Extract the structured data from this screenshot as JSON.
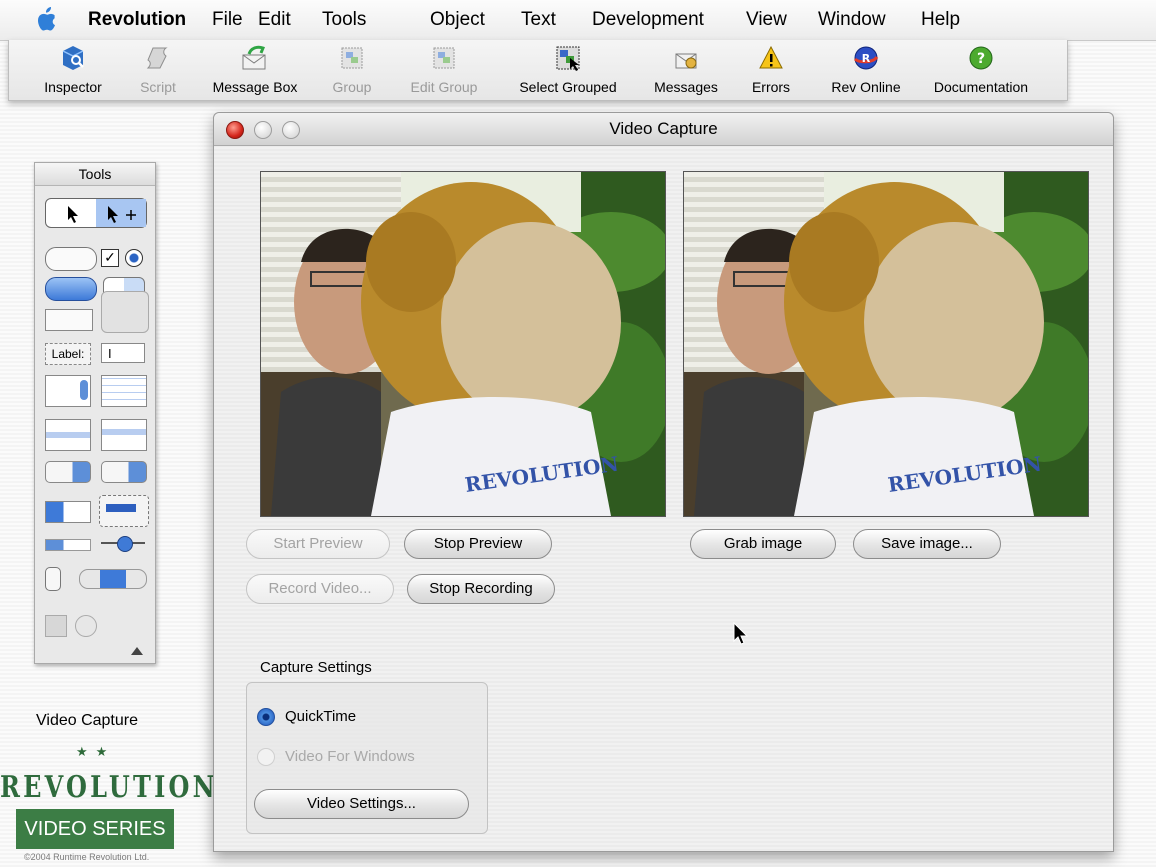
{
  "menubar": {
    "app_name": "Revolution",
    "items": [
      "File",
      "Edit",
      "Tools",
      "Object",
      "Text",
      "Development",
      "View",
      "Window",
      "Help"
    ]
  },
  "toolbar": {
    "items": [
      {
        "label": "Inspector",
        "icon": "inspector-icon",
        "enabled": true
      },
      {
        "label": "Script",
        "icon": "script-icon",
        "enabled": false
      },
      {
        "label": "Message Box",
        "icon": "message-box-icon",
        "enabled": true
      },
      {
        "label": "Group",
        "icon": "group-icon",
        "enabled": false
      },
      {
        "label": "Edit Group",
        "icon": "edit-group-icon",
        "enabled": false
      },
      {
        "label": "Select Grouped",
        "icon": "select-grouped-icon",
        "enabled": true
      },
      {
        "label": "Messages",
        "icon": "messages-icon",
        "enabled": true
      },
      {
        "label": "Errors",
        "icon": "errors-icon",
        "enabled": true
      },
      {
        "label": "Rev Online",
        "icon": "rev-online-icon",
        "enabled": true
      },
      {
        "label": "Documentation",
        "icon": "documentation-icon",
        "enabled": true
      }
    ]
  },
  "tools_palette": {
    "title": "Tools",
    "label_tool_text": "Label:"
  },
  "window": {
    "title": "Video Capture",
    "preview_image_text": "REVOLUTION",
    "buttons": {
      "start_preview": "Start Preview",
      "stop_preview": "Stop Preview",
      "record_video": "Record Video...",
      "stop_recording": "Stop Recording",
      "grab_image": "Grab image",
      "save_image": "Save image...",
      "video_settings": "Video Settings..."
    },
    "capture_settings": {
      "title": "Capture Settings",
      "options": [
        {
          "label": "QuickTime",
          "selected": true,
          "enabled": true
        },
        {
          "label": "Video For Windows",
          "selected": false,
          "enabled": false
        }
      ]
    }
  },
  "branding": {
    "title": "Video Capture",
    "logo_text": "REVOLUTION",
    "series_text": "VIDEO SERIES",
    "copyright": "©2004 Runtime Revolution Ltd."
  },
  "colors": {
    "brand_green": "#3c7d45",
    "radio_blue": "#2b64c4"
  }
}
